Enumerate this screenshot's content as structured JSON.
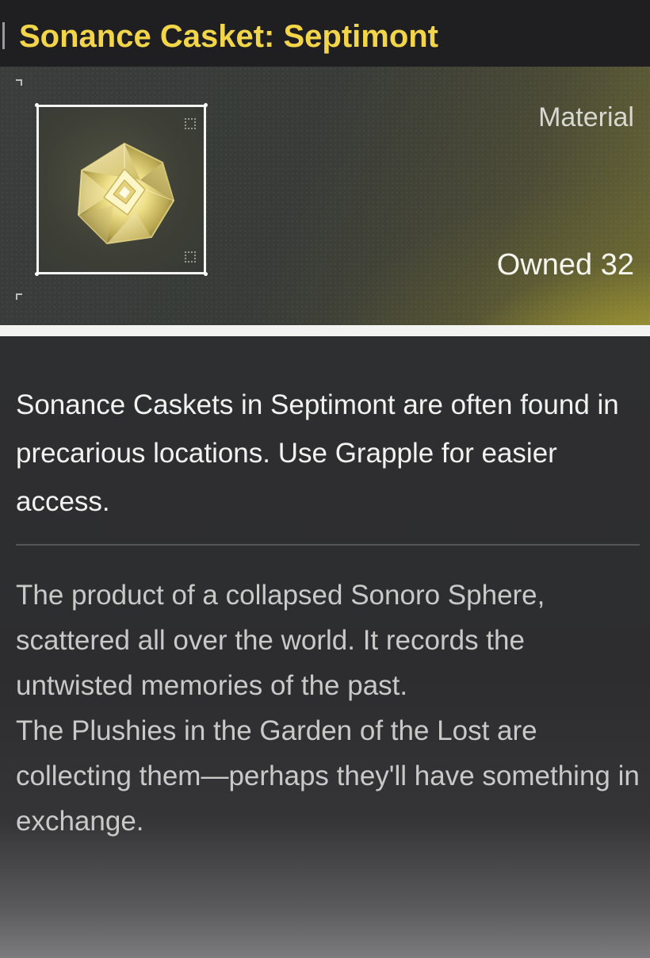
{
  "item": {
    "title": "Sonance Casket: Septimont",
    "type": "Material",
    "owned": "Owned 32",
    "icon": "crystal-gem-icon"
  },
  "description": {
    "usage": "Sonance Caskets in Septimont are often found in precarious locations. Use Grapple for easier access.",
    "lore_1": "The product of a collapsed Sonoro Sphere, scattered all over the world. It records the untwisted memories of the past.",
    "lore_2": "The Plushies in the Garden of the Lost are collecting them—perhaps they'll have something in exchange."
  },
  "colors": {
    "title": "#f3d54a",
    "accent_glow": "#ded23c",
    "frame": "#f4f4f2"
  }
}
